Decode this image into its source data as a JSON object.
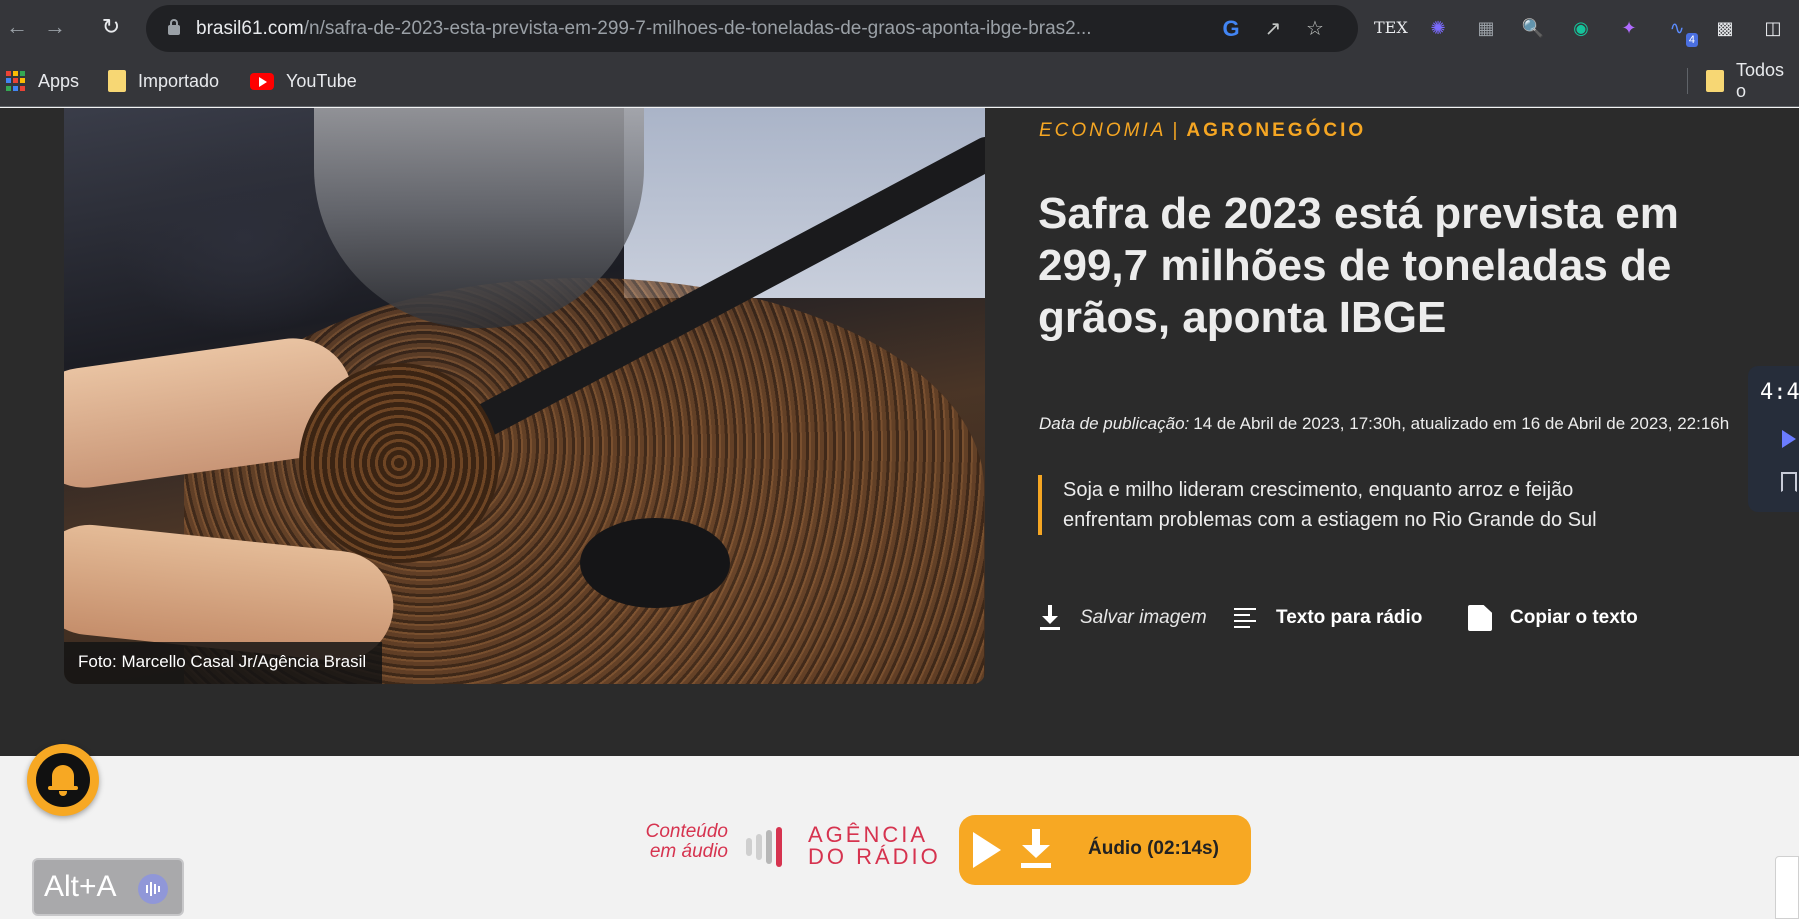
{
  "browser": {
    "url_host": "brasil61.com",
    "url_path": "/n/safra-de-2023-esta-prevista-em-299-7-milhoes-de-toneladas-de-graos-aponta-ibge-bras2...",
    "extension_badge": "4",
    "bookmarks": [
      {
        "label": "Apps",
        "icon": "apps-grid-icon"
      },
      {
        "label": "Importado",
        "icon": "folder-icon"
      },
      {
        "label": "YouTube",
        "icon": "youtube-icon"
      }
    ],
    "bookmarks_right": {
      "label": "Todos o",
      "icon": "folder-icon"
    }
  },
  "article": {
    "kicker_category": "ECONOMIA",
    "kicker_separator": "|",
    "kicker_subcategory": "AGRONEGÓCIO",
    "headline": "Safra de 2023 está prevista em 299,7 milhões de toneladas de grãos, aponta IBGE",
    "date_label": "Data de publicação:",
    "date_value": "14 de Abril de 2023, 17:30h, atualizado em 16 de Abril de 2023, 22:16h",
    "summary": "Soja e milho lideram crescimento, enquanto arroz e feijão enfrentam problemas com a estiagem no Rio Grande do Sul",
    "photo_caption": "Foto: Marcello Casal Jr/Agência Brasil",
    "actions": {
      "save_image": "Salvar imagem",
      "radio_text": "Texto para rádio",
      "copy_text": "Copiar o texto"
    }
  },
  "side_widget": {
    "time": "4:4"
  },
  "audio": {
    "conteudo_line1": "Conteúdo",
    "conteudo_line2": "em áudio",
    "brand_line1": "AGÊNCIA",
    "brand_line2": "DO RÁDIO",
    "button_label": "Áudio (02:14s)"
  },
  "shortcut": {
    "label": "Alt+A"
  },
  "colors": {
    "accent": "#f7a823",
    "brand_red": "#d6334f",
    "hero_bg": "#2b2b2b",
    "page_bg": "#f2f2f2"
  }
}
